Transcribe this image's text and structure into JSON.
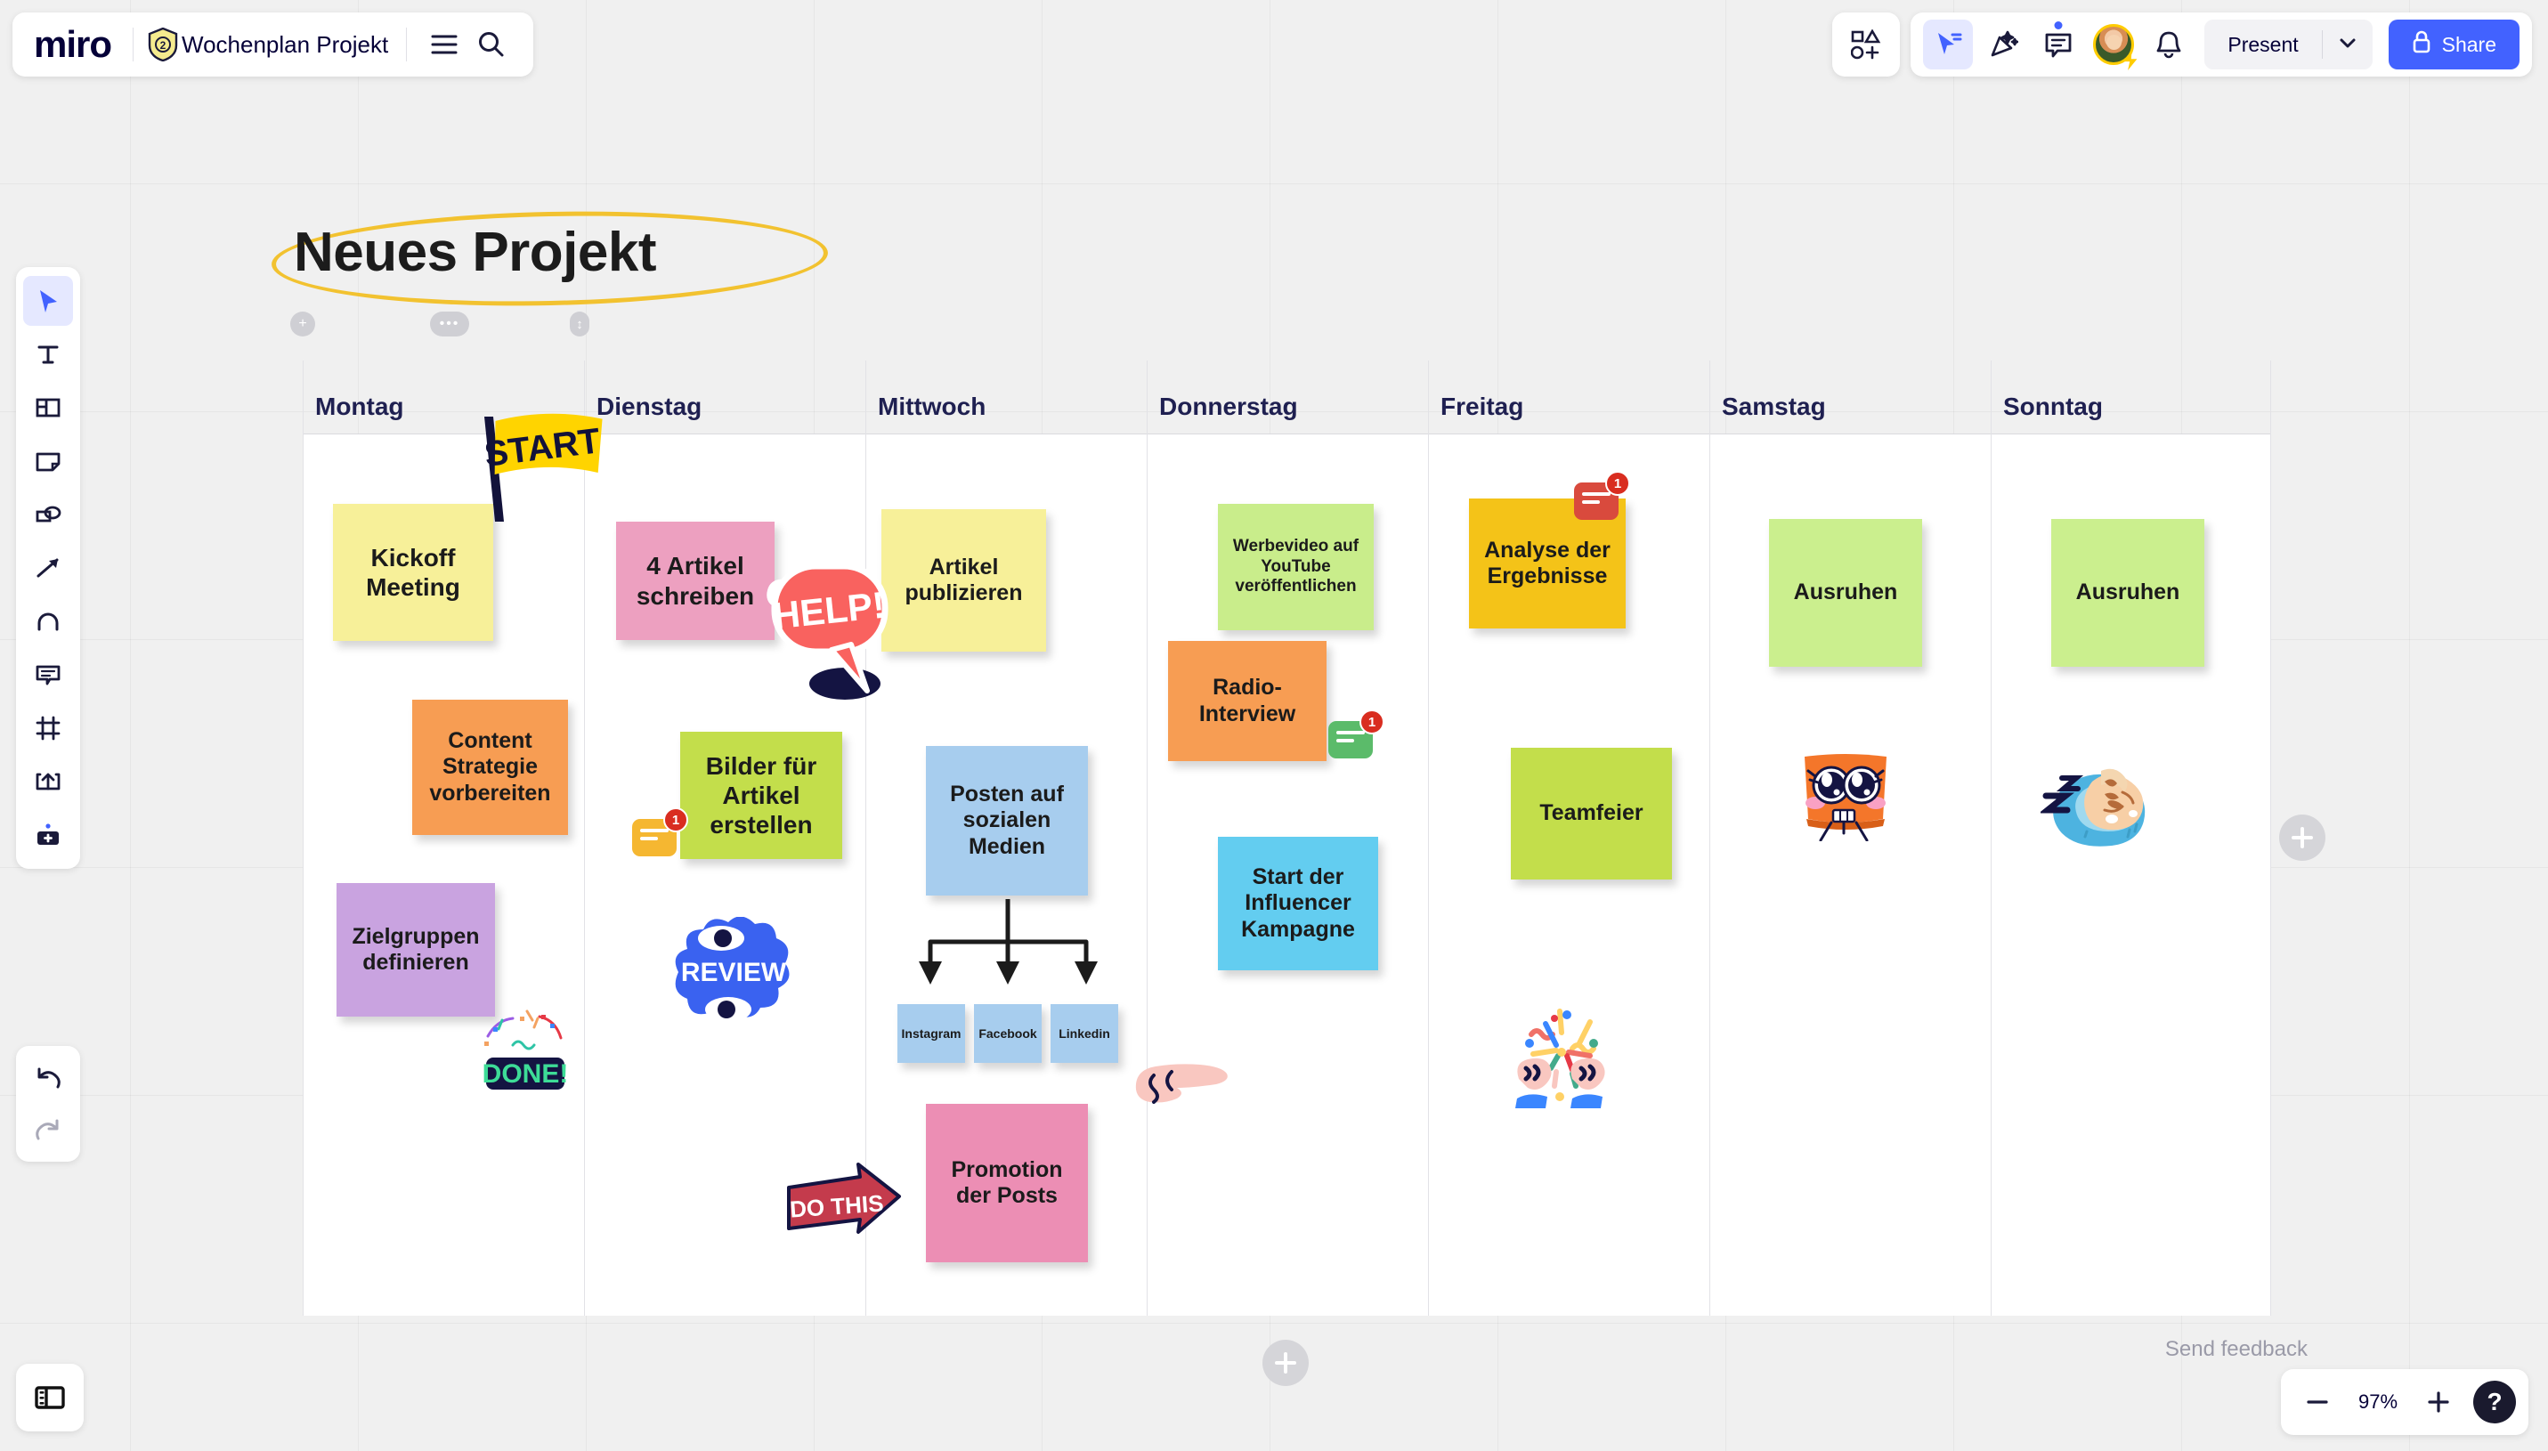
{
  "app": {
    "name": "miro",
    "plan_badge": "2",
    "board_title": "Wochenplan Projekt",
    "zoom_level": "97%",
    "send_feedback": "Send feedback"
  },
  "topbar": {
    "menu_icon": "hamburger-menu-icon",
    "search_icon": "search-icon",
    "shapes_icon": "shapes-icon",
    "cursor_icon": "cursor-select-icon",
    "reactions_icon": "reactions-icon",
    "comments_icon": "comments-icon",
    "notifications_icon": "bell-icon",
    "present_label": "Present",
    "present_caret": "chevron-down-icon",
    "share_label": "Share",
    "share_icon": "lock-icon"
  },
  "left_toolbar": {
    "items": [
      {
        "name": "select-tool",
        "icon": "cursor-icon",
        "active": true
      },
      {
        "name": "text-tool",
        "icon": "text-icon",
        "active": false
      },
      {
        "name": "templates-tool",
        "icon": "template-icon",
        "active": false
      },
      {
        "name": "sticky-note-tool",
        "icon": "sticky-note-icon",
        "active": false
      },
      {
        "name": "shapes-tool",
        "icon": "shapes-icon",
        "active": false
      },
      {
        "name": "connection-line-tool",
        "icon": "arrow-icon",
        "active": false
      },
      {
        "name": "pen-tool",
        "icon": "pen-icon",
        "active": false
      },
      {
        "name": "comment-tool",
        "icon": "comment-icon",
        "active": false
      },
      {
        "name": "frame-tool",
        "icon": "frame-icon",
        "active": false
      },
      {
        "name": "upload-tool",
        "icon": "upload-icon",
        "active": false
      },
      {
        "name": "more-apps-tool",
        "icon": "apps-plus-icon",
        "active": false
      }
    ],
    "undo": "undo-icon",
    "redo": "redo-icon",
    "panel_toggle": "side-panel-icon"
  },
  "zoom_controls": {
    "zoom_out": "minus-icon",
    "zoom_in": "plus-icon",
    "help": "?"
  },
  "board": {
    "heading": "Neues Projekt",
    "heading_highlight_color": "#f2c230",
    "days": [
      "Montag",
      "Dienstag",
      "Mittwoch",
      "Donnerstag",
      "Freitag",
      "Samstag",
      "Sonntag"
    ],
    "notes": [
      {
        "id": "n1",
        "text": "Kickoff Meeting",
        "day": "Montag",
        "color": "#f7f099",
        "size": "lg"
      },
      {
        "id": "n2",
        "text": "Content Strategie vorbereiten",
        "day": "Montag",
        "color": "#f79d53",
        "size": "md"
      },
      {
        "id": "n3",
        "text": "Zielgruppen definieren",
        "day": "Montag",
        "color": "#c9a3e0",
        "size": "md"
      },
      {
        "id": "n4",
        "text": "4 Artikel schreiben",
        "day": "Dienstag",
        "color": "#eda0c0",
        "size": "lg"
      },
      {
        "id": "n5",
        "text": "Bilder für Artikel erstellen",
        "day": "Dienstag",
        "color": "#c3de4b",
        "size": "lg"
      },
      {
        "id": "n6",
        "text": "Artikel publizieren",
        "day": "Mittwoch",
        "color": "#f7f099",
        "size": "md"
      },
      {
        "id": "n7",
        "text": "Posten auf sozialen Medien",
        "day": "Mittwoch",
        "color": "#a7cdee",
        "size": "md"
      },
      {
        "id": "n8",
        "text": "Instagram",
        "day": "Mittwoch",
        "color": "#a7cdee",
        "size": "xs"
      },
      {
        "id": "n9",
        "text": "Facebook",
        "day": "Mittwoch",
        "color": "#a7cdee",
        "size": "xs"
      },
      {
        "id": "n10",
        "text": "Linkedin",
        "day": "Mittwoch",
        "color": "#a7cdee",
        "size": "xs"
      },
      {
        "id": "n11",
        "text": "Promotion der Posts",
        "day": "Mittwoch",
        "color": "#ec8eb4",
        "size": "md"
      },
      {
        "id": "n12",
        "text": "Werbevideo auf YouTube veröffentlichen",
        "day": "Donnerstag",
        "color": "#c9ed8b",
        "size": "sm"
      },
      {
        "id": "n13",
        "text": "Radio-Interview",
        "day": "Donnerstag",
        "color": "#f79d53",
        "size": "md"
      },
      {
        "id": "n14",
        "text": "Start der Influencer Kampagne",
        "day": "Donnerstag",
        "color": "#63cdf0",
        "size": "md"
      },
      {
        "id": "n15",
        "text": "Analyse der Ergebnisse",
        "day": "Freitag",
        "color": "#f4c318",
        "size": "md"
      },
      {
        "id": "n16",
        "text": "Teamfeier",
        "day": "Freitag",
        "color": "#c3de4b",
        "size": "md"
      },
      {
        "id": "n17",
        "text": "Ausruhen",
        "day": "Samstag",
        "color": "#cbef8e",
        "size": "md"
      },
      {
        "id": "n18",
        "text": "Ausruhen",
        "day": "Sonntag",
        "color": "#cbef8e",
        "size": "md"
      }
    ],
    "stickers": [
      {
        "id": "s1",
        "name": "start-flag-sticker",
        "text": "START"
      },
      {
        "id": "s2",
        "name": "help-bubble-sticker",
        "text": "HELP!"
      },
      {
        "id": "s3",
        "name": "review-eyes-sticker",
        "text": "REVIEW"
      },
      {
        "id": "s4",
        "name": "done-confetti-sticker",
        "text": "DONE!"
      },
      {
        "id": "s5",
        "name": "do-this-arrow-sticker",
        "text": "DO THIS"
      },
      {
        "id": "s6",
        "name": "pointing-hand-sticker",
        "text": ""
      },
      {
        "id": "s7",
        "name": "celebration-hands-sticker",
        "text": ""
      },
      {
        "id": "s8",
        "name": "excited-face-sticker",
        "text": ""
      },
      {
        "id": "s9",
        "name": "sleeping-face-sticker",
        "text": ""
      }
    ],
    "comment_badges": [
      {
        "id": "c1",
        "count": "1",
        "color": "#f5b731",
        "day": "Dienstag"
      },
      {
        "id": "c2",
        "count": "1",
        "color": "#5bbb6a",
        "day": "Donnerstag"
      },
      {
        "id": "c3",
        "count": "1",
        "color": "#d94a3d",
        "day": "Freitag"
      }
    ]
  }
}
